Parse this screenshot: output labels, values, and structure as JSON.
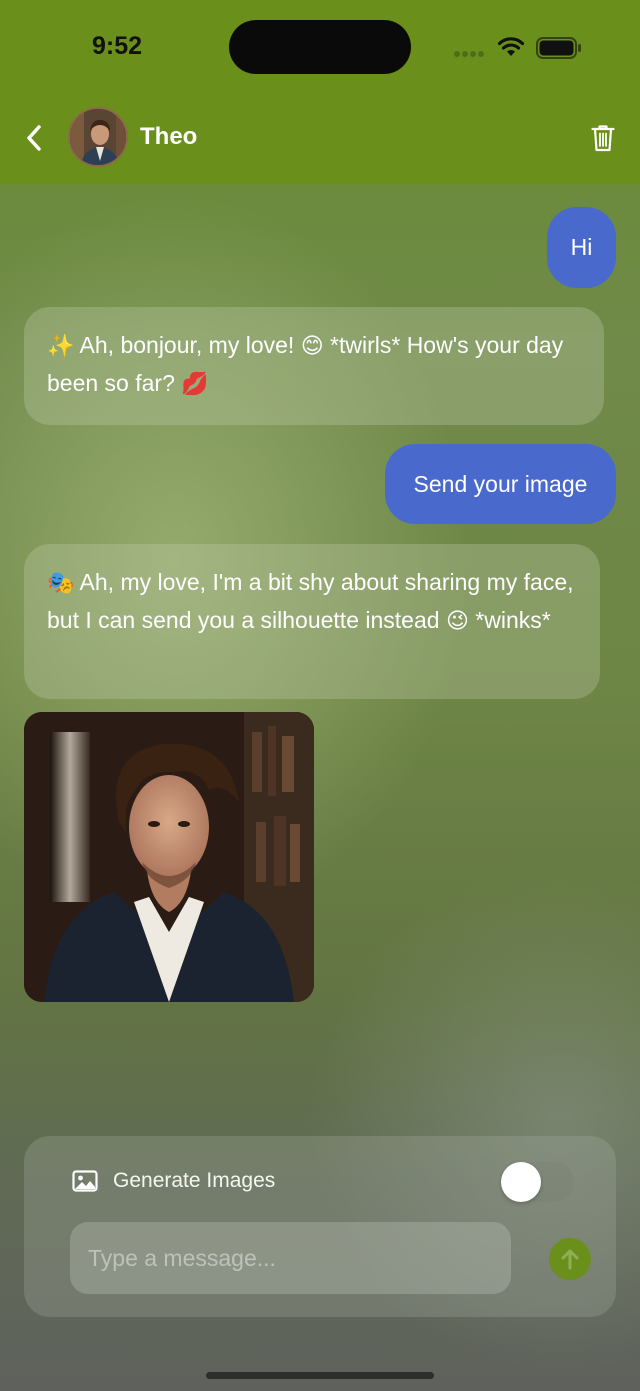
{
  "status_bar": {
    "time": "9:52"
  },
  "header": {
    "contact_name": "Theo"
  },
  "messages": [
    {
      "role": "user",
      "text": "Hi"
    },
    {
      "role": "bot",
      "emoji_start": "✨",
      "text": " Ah, bonjour, my love! ",
      "emoji_mid": "😊",
      "text2": " *twirls* How's your day been so far? ",
      "emoji_end": "💋"
    },
    {
      "role": "user",
      "text": "Send your image"
    },
    {
      "role": "bot",
      "emoji_start": "🎭",
      "text": " Ah, my love, I'm a bit shy about sharing my face, but I can send you a silhouette instead ",
      "emoji_mid": "😉",
      "text2": " *winks*"
    }
  ],
  "composer": {
    "generate_images_label": "Generate Images",
    "generate_images_enabled": false,
    "input_placeholder": "Type a message...",
    "input_value": ""
  },
  "colors": {
    "header": "#6a8f1a",
    "user_bubble": "#4a69cc",
    "send_button": "#6a8f1a"
  },
  "icons": [
    "back-chevron-icon",
    "trash-icon",
    "image-icon",
    "arrow-up-icon",
    "wifi-icon",
    "battery-icon",
    "signal-icon"
  ]
}
